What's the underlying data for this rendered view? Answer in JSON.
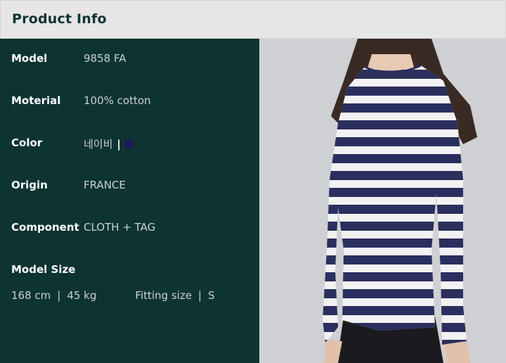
{
  "header": {
    "title": "Product Info"
  },
  "specs": [
    {
      "label": "Model",
      "value": "9858 FA"
    },
    {
      "label": "Moterial",
      "value": "100% cotton"
    },
    {
      "label": "Color",
      "value": "네이비"
    },
    {
      "label": "Origin",
      "value": "FRANCE"
    },
    {
      "label": "Component",
      "value": "CLOTH + TAG"
    }
  ],
  "color_separator": "|",
  "color_swatch": "#1a1a5e",
  "model_size": {
    "label": "Model Size",
    "height": "168 cm",
    "separator": "|",
    "weight": "45 kg",
    "fitting_label": "Fitting size",
    "fitting_separator": "|",
    "fitting_value": "S"
  },
  "theme": {
    "panel_bg": "#0e3333",
    "header_bg": "#e6e6e6",
    "stripe_navy": "#2a2f5e",
    "stripe_white": "#f2f2f2"
  },
  "photo": {
    "subject": "model-wearing-striped-shirt"
  }
}
